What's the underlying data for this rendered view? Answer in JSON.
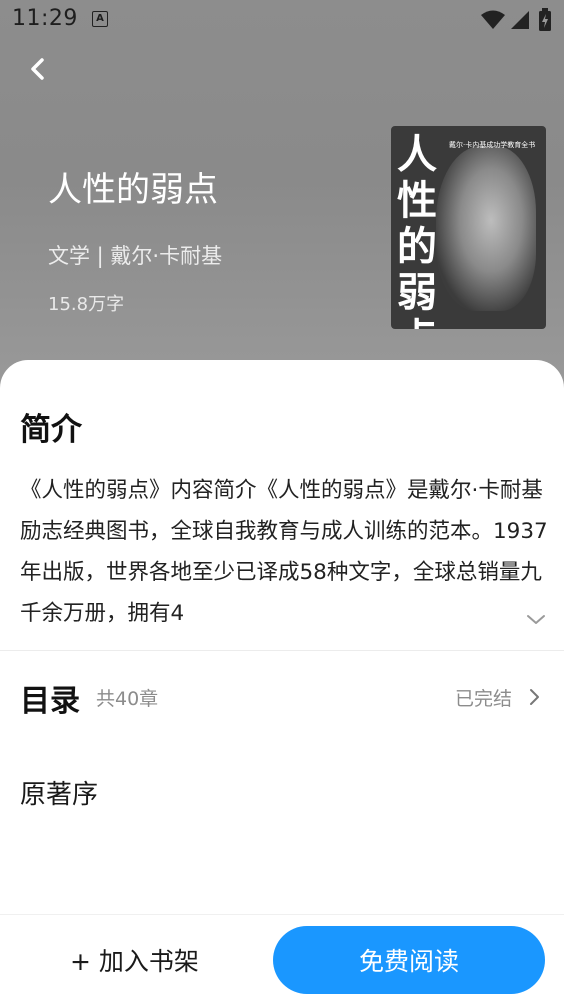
{
  "status_bar": {
    "time": "11:29",
    "notification_icon": "a-icon",
    "wifi_icon": "wifi-icon",
    "signal_icon": "signal-icon",
    "battery_icon": "battery-icon"
  },
  "header": {
    "back_icon": "chevron-left-icon"
  },
  "book": {
    "title": "人性的弱点",
    "meta": "文学 | 戴尔·卡耐基",
    "word_count": "15.8万字",
    "cover": {
      "title": "人性的弱点",
      "subtitle": "戴尔·卡内基成功学教育全书"
    }
  },
  "intro": {
    "heading": "简介",
    "text": "《人性的弱点》内容简介《人性的弱点》是戴尔·卡耐基励志经典图书，全球自我教育与成人训练的范本。1937年出版，世界各地至少已译成58种文字，全球总销量九千余万册，拥有4",
    "expand_icon": "chevron-down-icon"
  },
  "toc": {
    "heading": "目录",
    "count": "共40章",
    "status": "已完结",
    "status_icon": "chevron-right-icon",
    "first_chapter": "原著序"
  },
  "bottom_bar": {
    "add_label": "+ 加入书架",
    "read_label": "免费阅读"
  },
  "colors": {
    "accent": "#1a97ff",
    "hero_bg": "#8d8d8d"
  }
}
